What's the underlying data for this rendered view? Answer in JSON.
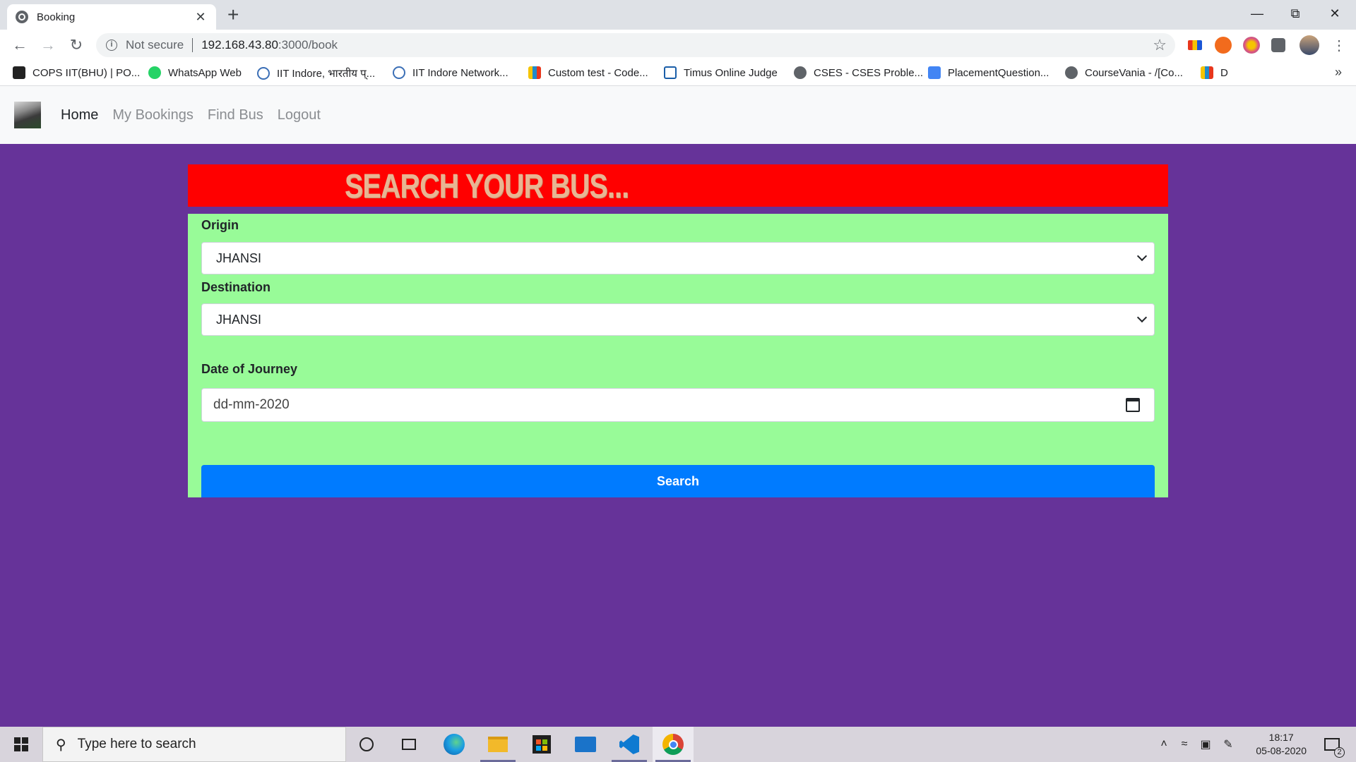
{
  "browser": {
    "tab_title": "Booking",
    "tab_close": "✕",
    "new_tab": "+",
    "not_secure": "Not secure",
    "url_host": "192.168.43.80",
    "url_rest": ":3000/book",
    "bookmarks": [
      {
        "label": "COPS IIT(BHU) | PO...",
        "icon_color": "#222"
      },
      {
        "label": "WhatsApp Web",
        "icon_color": "#25d366"
      },
      {
        "label": "IIT Indore, भारतीय प्...",
        "icon_color": "#3b6fb6"
      },
      {
        "label": "IIT Indore Network...",
        "icon_color": "#3b6fb6"
      },
      {
        "label": "Custom test - Code...",
        "icon_color": "#1f8acb"
      },
      {
        "label": "Timus Online Judge",
        "icon_color": "#1a5ea8"
      },
      {
        "label": "CSES - CSES Proble...",
        "icon_color": "#5f6368"
      },
      {
        "label": "PlacementQuestion...",
        "icon_color": "#4285f4"
      },
      {
        "label": "CourseVania - /[Co...",
        "icon_color": "#5f6368"
      },
      {
        "label": "D",
        "icon_color": "#1f8acb"
      }
    ],
    "bookmarks_more": "»"
  },
  "navbar": {
    "links": [
      "Home",
      "My Bookings",
      "Find Bus",
      "Logout"
    ]
  },
  "search_form": {
    "banner": "SEARCH YOUR BUS...",
    "origin_label": "Origin",
    "origin_value": "JHANSI",
    "destination_label": "Destination",
    "destination_value": "JHANSI",
    "date_label": "Date of Journey",
    "date_value": "dd-mm-2020",
    "search_button": "Search"
  },
  "taskbar": {
    "search_placeholder": "Type here to search",
    "time": "18:17",
    "date": "05-08-2020",
    "notification_count": "2"
  },
  "colors": {
    "page_bg": "#663399",
    "banner_bg": "#ff0000",
    "form_bg": "#98fb98",
    "button_bg": "#007bff"
  }
}
